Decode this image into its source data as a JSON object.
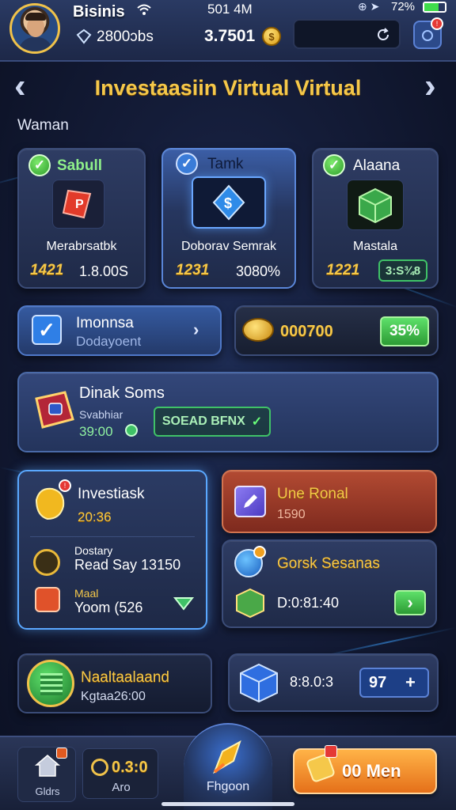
{
  "status_bar": {
    "time": "501 4M",
    "battery": "72%"
  },
  "profile": {
    "name": "Bisinis",
    "gems": "2800ɔbs"
  },
  "header": {
    "coins": "3.7501",
    "search_placeholder": ""
  },
  "title_bar": {
    "title": "Investaasiin Virtual Virtual",
    "prev": "‹",
    "next": "›"
  },
  "section_label": "Waman",
  "cards_top": [
    {
      "title": "Sabull",
      "name": "Merabrsatbk",
      "stat_a": "1421",
      "stat_b": "1.8.00S"
    },
    {
      "title": "Tamk",
      "name": "Doborav Semrak",
      "stat_a": "1231",
      "stat_b": "3080%"
    },
    {
      "title": "Alaana",
      "name": "Mastala",
      "stat_a": "1221",
      "stat_b": "3:S¾8"
    }
  ],
  "quest_button": {
    "title": "Imonnsa",
    "subtitle": "Dodayoent"
  },
  "coin_bar": {
    "value": "000700",
    "badge": "35%"
  },
  "banner": {
    "title": "Dinak Soms",
    "label": "Svabhiar",
    "value": "39:00",
    "action": "SOEAD BFNX"
  },
  "invest_panel": {
    "title": "Investiask",
    "value": "20:36",
    "rows": [
      {
        "label": "Dostary",
        "value": "Read Say 13150"
      },
      {
        "label": "Maal",
        "value": "Yoom (526"
      }
    ]
  },
  "bonus_panel": {
    "title": "Une Ronal",
    "value": "1590"
  },
  "season_panel": {
    "title": "Gorsk Sesanas",
    "value": "D:0:81:40"
  },
  "neighbor": {
    "title": "Naaltaalaand",
    "subtitle": "Kgtaa26:00"
  },
  "trade_box": {
    "value": "8:8.0:3",
    "input_value": "97",
    "plus": "+"
  },
  "bottom_nav": {
    "home_label": "Gldrs",
    "timer": "0.3:0",
    "timer_label": "Aro",
    "center_label": "Fhgoon",
    "cta": "00 Men"
  },
  "colors": {
    "gold": "#f5c84a",
    "green": "#3fc267",
    "red_panel": "#9a3a2a",
    "orange_cta": "#f39a2a",
    "accent_blue": "#2f72d8"
  }
}
